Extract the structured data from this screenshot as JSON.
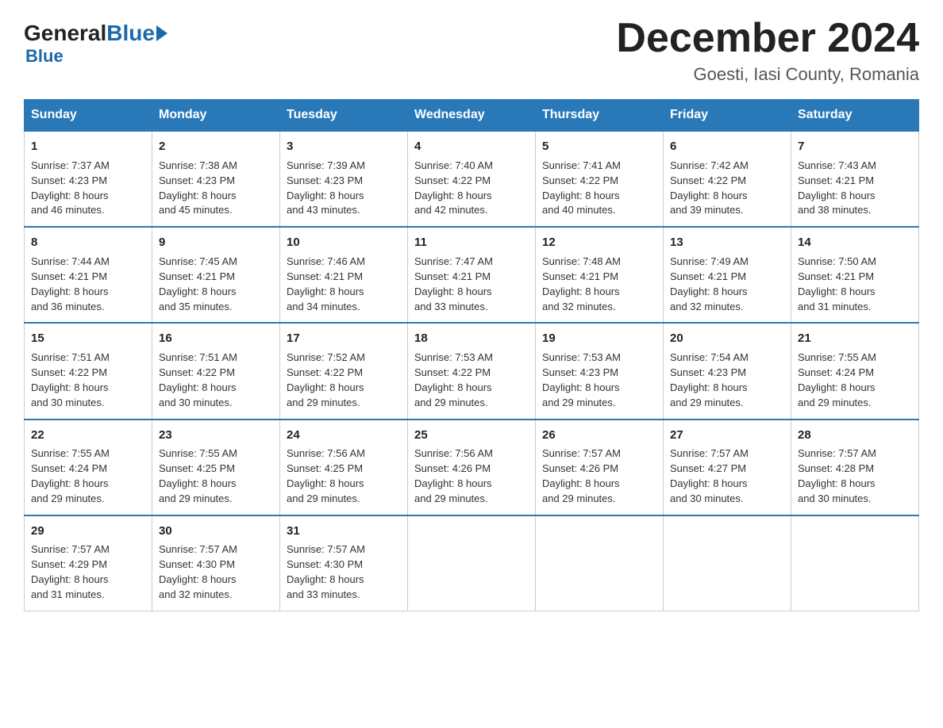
{
  "header": {
    "logo": {
      "general": "General",
      "blue": "Blue",
      "subtitle": "Blue"
    },
    "title": "December 2024",
    "location": "Goesti, Iasi County, Romania"
  },
  "days_of_week": [
    "Sunday",
    "Monday",
    "Tuesday",
    "Wednesday",
    "Thursday",
    "Friday",
    "Saturday"
  ],
  "weeks": [
    [
      {
        "day": "1",
        "sunrise": "7:37 AM",
        "sunset": "4:23 PM",
        "daylight": "8 hours and 46 minutes."
      },
      {
        "day": "2",
        "sunrise": "7:38 AM",
        "sunset": "4:23 PM",
        "daylight": "8 hours and 45 minutes."
      },
      {
        "day": "3",
        "sunrise": "7:39 AM",
        "sunset": "4:23 PM",
        "daylight": "8 hours and 43 minutes."
      },
      {
        "day": "4",
        "sunrise": "7:40 AM",
        "sunset": "4:22 PM",
        "daylight": "8 hours and 42 minutes."
      },
      {
        "day": "5",
        "sunrise": "7:41 AM",
        "sunset": "4:22 PM",
        "daylight": "8 hours and 40 minutes."
      },
      {
        "day": "6",
        "sunrise": "7:42 AM",
        "sunset": "4:22 PM",
        "daylight": "8 hours and 39 minutes."
      },
      {
        "day": "7",
        "sunrise": "7:43 AM",
        "sunset": "4:21 PM",
        "daylight": "8 hours and 38 minutes."
      }
    ],
    [
      {
        "day": "8",
        "sunrise": "7:44 AM",
        "sunset": "4:21 PM",
        "daylight": "8 hours and 36 minutes."
      },
      {
        "day": "9",
        "sunrise": "7:45 AM",
        "sunset": "4:21 PM",
        "daylight": "8 hours and 35 minutes."
      },
      {
        "day": "10",
        "sunrise": "7:46 AM",
        "sunset": "4:21 PM",
        "daylight": "8 hours and 34 minutes."
      },
      {
        "day": "11",
        "sunrise": "7:47 AM",
        "sunset": "4:21 PM",
        "daylight": "8 hours and 33 minutes."
      },
      {
        "day": "12",
        "sunrise": "7:48 AM",
        "sunset": "4:21 PM",
        "daylight": "8 hours and 32 minutes."
      },
      {
        "day": "13",
        "sunrise": "7:49 AM",
        "sunset": "4:21 PM",
        "daylight": "8 hours and 32 minutes."
      },
      {
        "day": "14",
        "sunrise": "7:50 AM",
        "sunset": "4:21 PM",
        "daylight": "8 hours and 31 minutes."
      }
    ],
    [
      {
        "day": "15",
        "sunrise": "7:51 AM",
        "sunset": "4:22 PM",
        "daylight": "8 hours and 30 minutes."
      },
      {
        "day": "16",
        "sunrise": "7:51 AM",
        "sunset": "4:22 PM",
        "daylight": "8 hours and 30 minutes."
      },
      {
        "day": "17",
        "sunrise": "7:52 AM",
        "sunset": "4:22 PM",
        "daylight": "8 hours and 29 minutes."
      },
      {
        "day": "18",
        "sunrise": "7:53 AM",
        "sunset": "4:22 PM",
        "daylight": "8 hours and 29 minutes."
      },
      {
        "day": "19",
        "sunrise": "7:53 AM",
        "sunset": "4:23 PM",
        "daylight": "8 hours and 29 minutes."
      },
      {
        "day": "20",
        "sunrise": "7:54 AM",
        "sunset": "4:23 PM",
        "daylight": "8 hours and 29 minutes."
      },
      {
        "day": "21",
        "sunrise": "7:55 AM",
        "sunset": "4:24 PM",
        "daylight": "8 hours and 29 minutes."
      }
    ],
    [
      {
        "day": "22",
        "sunrise": "7:55 AM",
        "sunset": "4:24 PM",
        "daylight": "8 hours and 29 minutes."
      },
      {
        "day": "23",
        "sunrise": "7:55 AM",
        "sunset": "4:25 PM",
        "daylight": "8 hours and 29 minutes."
      },
      {
        "day": "24",
        "sunrise": "7:56 AM",
        "sunset": "4:25 PM",
        "daylight": "8 hours and 29 minutes."
      },
      {
        "day": "25",
        "sunrise": "7:56 AM",
        "sunset": "4:26 PM",
        "daylight": "8 hours and 29 minutes."
      },
      {
        "day": "26",
        "sunrise": "7:57 AM",
        "sunset": "4:26 PM",
        "daylight": "8 hours and 29 minutes."
      },
      {
        "day": "27",
        "sunrise": "7:57 AM",
        "sunset": "4:27 PM",
        "daylight": "8 hours and 30 minutes."
      },
      {
        "day": "28",
        "sunrise": "7:57 AM",
        "sunset": "4:28 PM",
        "daylight": "8 hours and 30 minutes."
      }
    ],
    [
      {
        "day": "29",
        "sunrise": "7:57 AM",
        "sunset": "4:29 PM",
        "daylight": "8 hours and 31 minutes."
      },
      {
        "day": "30",
        "sunrise": "7:57 AM",
        "sunset": "4:30 PM",
        "daylight": "8 hours and 32 minutes."
      },
      {
        "day": "31",
        "sunrise": "7:57 AM",
        "sunset": "4:30 PM",
        "daylight": "8 hours and 33 minutes."
      },
      null,
      null,
      null,
      null
    ]
  ],
  "labels": {
    "sunrise": "Sunrise:",
    "sunset": "Sunset:",
    "daylight": "Daylight:"
  }
}
